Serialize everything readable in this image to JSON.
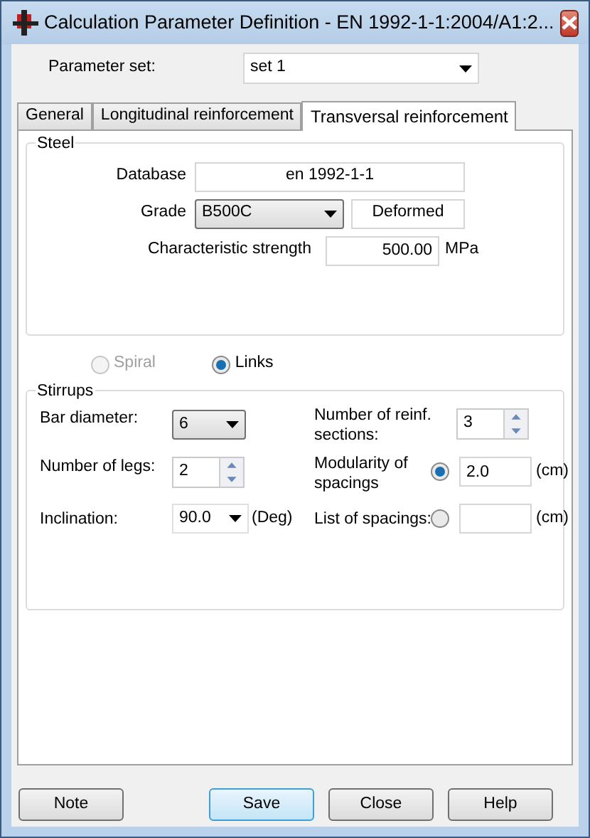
{
  "window": {
    "title": "Calculation Parameter Definition - EN 1992-1-1:2004/A1:2..."
  },
  "parameter_set": {
    "label": "Parameter set:",
    "value": "set 1"
  },
  "tabs": [
    {
      "label": "General",
      "selected": false
    },
    {
      "label": "Longitudinal reinforcement",
      "selected": false
    },
    {
      "label": "Transversal reinforcement",
      "selected": true
    }
  ],
  "steel": {
    "title": "Steel",
    "database_label": "Database",
    "database": "en 1992-1-1",
    "grade_label": "Grade",
    "grade": "B500C",
    "surface": "Deformed",
    "strength_label": "Characteristic strength",
    "strength": "500.00",
    "strength_unit": "MPa"
  },
  "type_options": [
    {
      "label": "Spiral",
      "selected": false,
      "disabled": true
    },
    {
      "label": "Links",
      "selected": true,
      "disabled": false
    }
  ],
  "stirrups": {
    "title": "Stirrups",
    "bar_diameter_label": "Bar diameter:",
    "bar_diameter": "6",
    "sections_label": "Number of reinf. sections:",
    "sections": "3",
    "legs_label": "Number of legs:",
    "legs": "2",
    "modularity_label": "Modularity of spacings",
    "modularity_selected": true,
    "modularity": "2.0",
    "modularity_unit": "(cm)",
    "inclination_label": "Inclination:",
    "inclination": "90.0",
    "inclination_unit": "(Deg)",
    "list_label": "List of spacings:",
    "list_selected": false,
    "list_unit": "(cm)"
  },
  "buttons": [
    {
      "label": "Note",
      "default": false
    },
    {
      "label": "Save",
      "default": true
    },
    {
      "label": "Close",
      "default": false
    },
    {
      "label": "Help",
      "default": false
    }
  ]
}
